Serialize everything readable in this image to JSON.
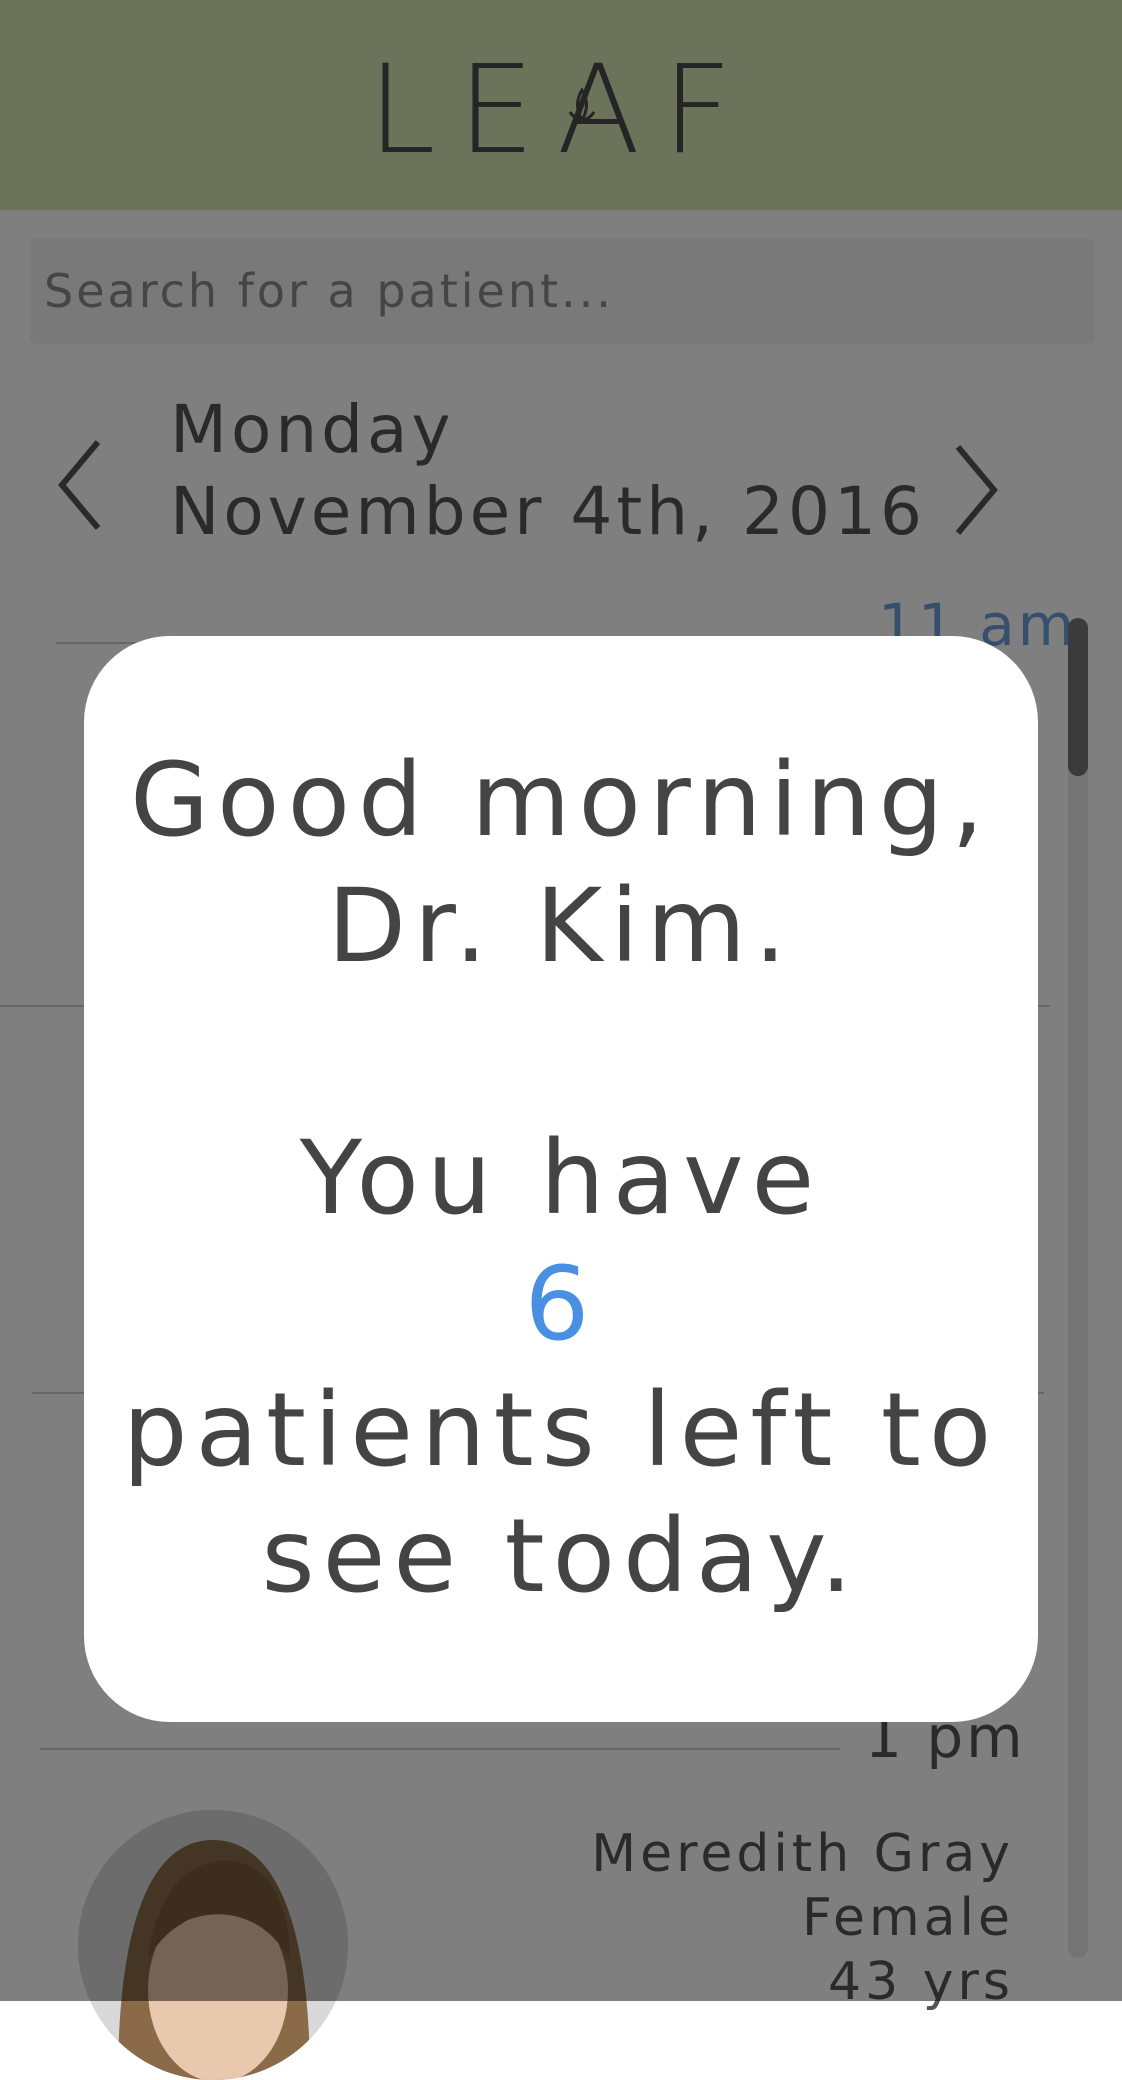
{
  "app": {
    "logo_text": "LEAF"
  },
  "search": {
    "placeholder": "Search for a patient..."
  },
  "date_nav": {
    "day": "Monday",
    "date": "November 4th, 2016",
    "prev_icon": "chevron-left-icon",
    "next_icon": "chevron-right-icon"
  },
  "schedule": {
    "slots": [
      {
        "time": "11 am"
      },
      {
        "time": "1 pm"
      }
    ],
    "patient": {
      "name": "Meredith Gray",
      "sex": "Female",
      "age": "43 yrs"
    }
  },
  "modal": {
    "line1": "Good morning,",
    "line2": "Dr. Kim.",
    "line3": "You have",
    "count": "6",
    "line4": "patients left to",
    "line5": "see today."
  },
  "colors": {
    "header": "#d6e6b4",
    "accent": "#4a90e2",
    "text": "#444444",
    "overlay": "rgba(0,0,0,0.5)"
  }
}
